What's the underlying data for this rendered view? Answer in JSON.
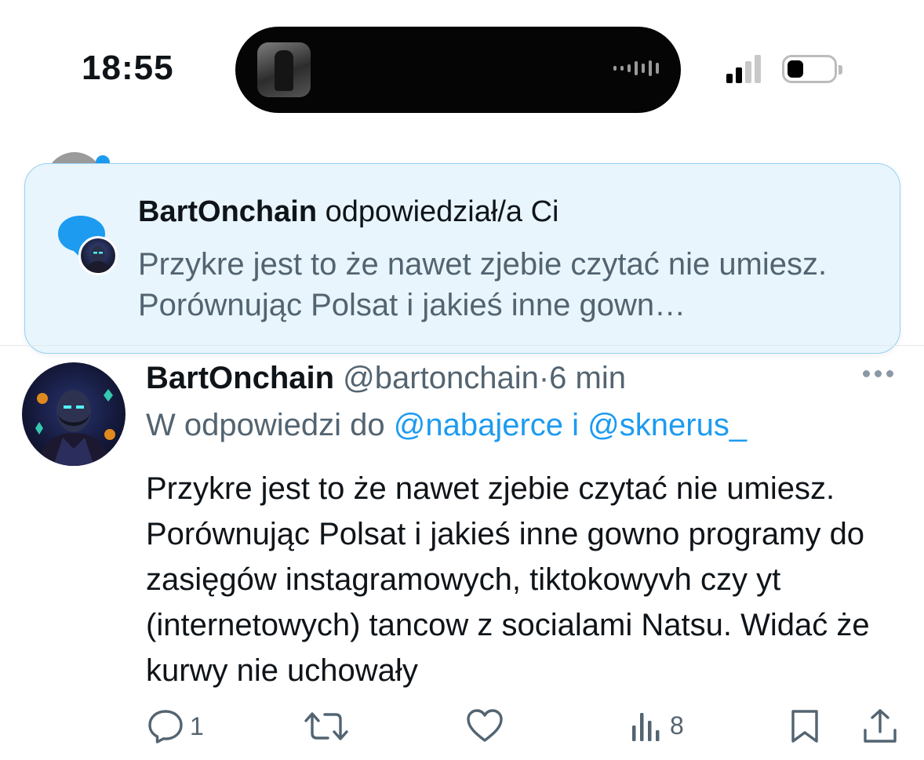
{
  "status_bar": {
    "time": "18:55"
  },
  "notification": {
    "author": "BartOnchain",
    "action": "odpowiedział/a Ci",
    "excerpt": "Przykre jest to że nawet zjebie czytać nie umiesz. Porównując Polsat i jakieś inne gown…"
  },
  "tweet": {
    "display_name": "BartOnchain",
    "handle": "@bartonchain",
    "separator": "·",
    "time_ago": "6 min",
    "reply_prefix": "W odpowiedzi do",
    "mention_1": "@nabajerce",
    "mention_joiner": "i",
    "mention_2": "@sknerus_",
    "text": "Przykre jest to że nawet zjebie czytać nie umiesz. Porównując Polsat i jakieś inne gowno programy do zasięgów instagramowych, tiktokowyvh czy yt (internetowych) tancow z socialami Natsu. Widać że kurwy nie uchowały"
  },
  "actions": {
    "reply_count": "1",
    "retweet_count": "",
    "like_count": "",
    "views_count": "8"
  },
  "icons": {
    "reply": "reply-icon",
    "retweet": "retweet-icon",
    "like": "heart-icon",
    "views": "views-icon",
    "bookmark": "bookmark-icon",
    "share": "share-icon",
    "more": "more-icon"
  },
  "colors": {
    "accent": "#1d9bf0",
    "secondary_text": "#536471",
    "banner_bg": "#e8f5fd",
    "banner_border": "#98cff2"
  }
}
